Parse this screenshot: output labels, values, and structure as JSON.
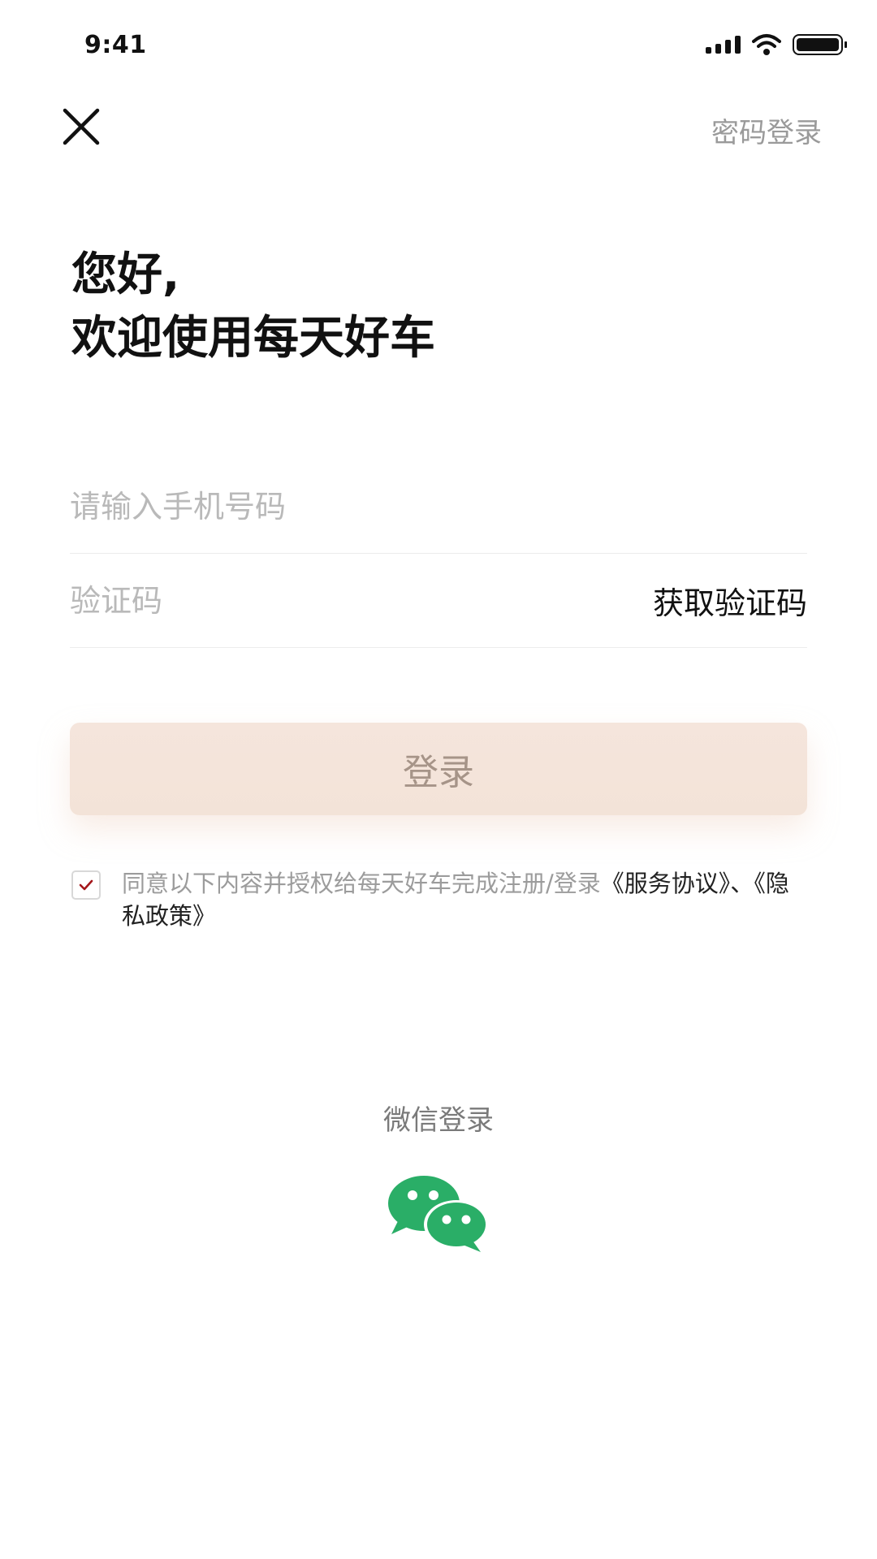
{
  "status_bar": {
    "time": "9:41",
    "icons": [
      "signal-icon",
      "wifi-icon",
      "battery-icon"
    ]
  },
  "top_bar": {
    "close_icon": "close-icon",
    "password_login": "密码登录"
  },
  "greeting": {
    "line1": "您好,",
    "line2": "欢迎使用每天好车"
  },
  "form": {
    "phone_placeholder": "请输入手机号码",
    "code_placeholder": "验证码",
    "get_code": "获取验证码"
  },
  "login_button": "登录",
  "agreement": {
    "checked": true,
    "text": "同意以下内容并授权给每天好车完成注册/登录",
    "service_agreement": "《服务协议》",
    "separator": "、",
    "privacy_policy": "《隐私政策》"
  },
  "wechat": {
    "label": "微信登录",
    "icon": "wechat-icon"
  },
  "colors": {
    "wechat_green": "#2aae67",
    "checkbox_mark": "#a4161a",
    "login_button_bg": "#f5e5dc",
    "login_button_text": "#a69488",
    "muted_text": "#9c9c9c"
  }
}
